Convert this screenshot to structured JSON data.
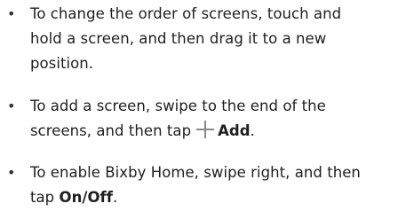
{
  "bullets": [
    {
      "lines": [
        "To change the order of screens, touch and",
        "hold a screen, and then drag it to a new",
        "position."
      ]
    },
    {
      "line1": "To add a screen, swipe to the end of the",
      "line2_before": "screens, and then tap",
      "icon": "plus-icon",
      "line2_bold": "Add",
      "line2_after": "."
    },
    {
      "line1": "To enable Bixby Home, swipe right, and then",
      "line2_before": "tap ",
      "line2_bold": "On/Off",
      "line2_after": "."
    }
  ],
  "bullet_glyph": "•"
}
